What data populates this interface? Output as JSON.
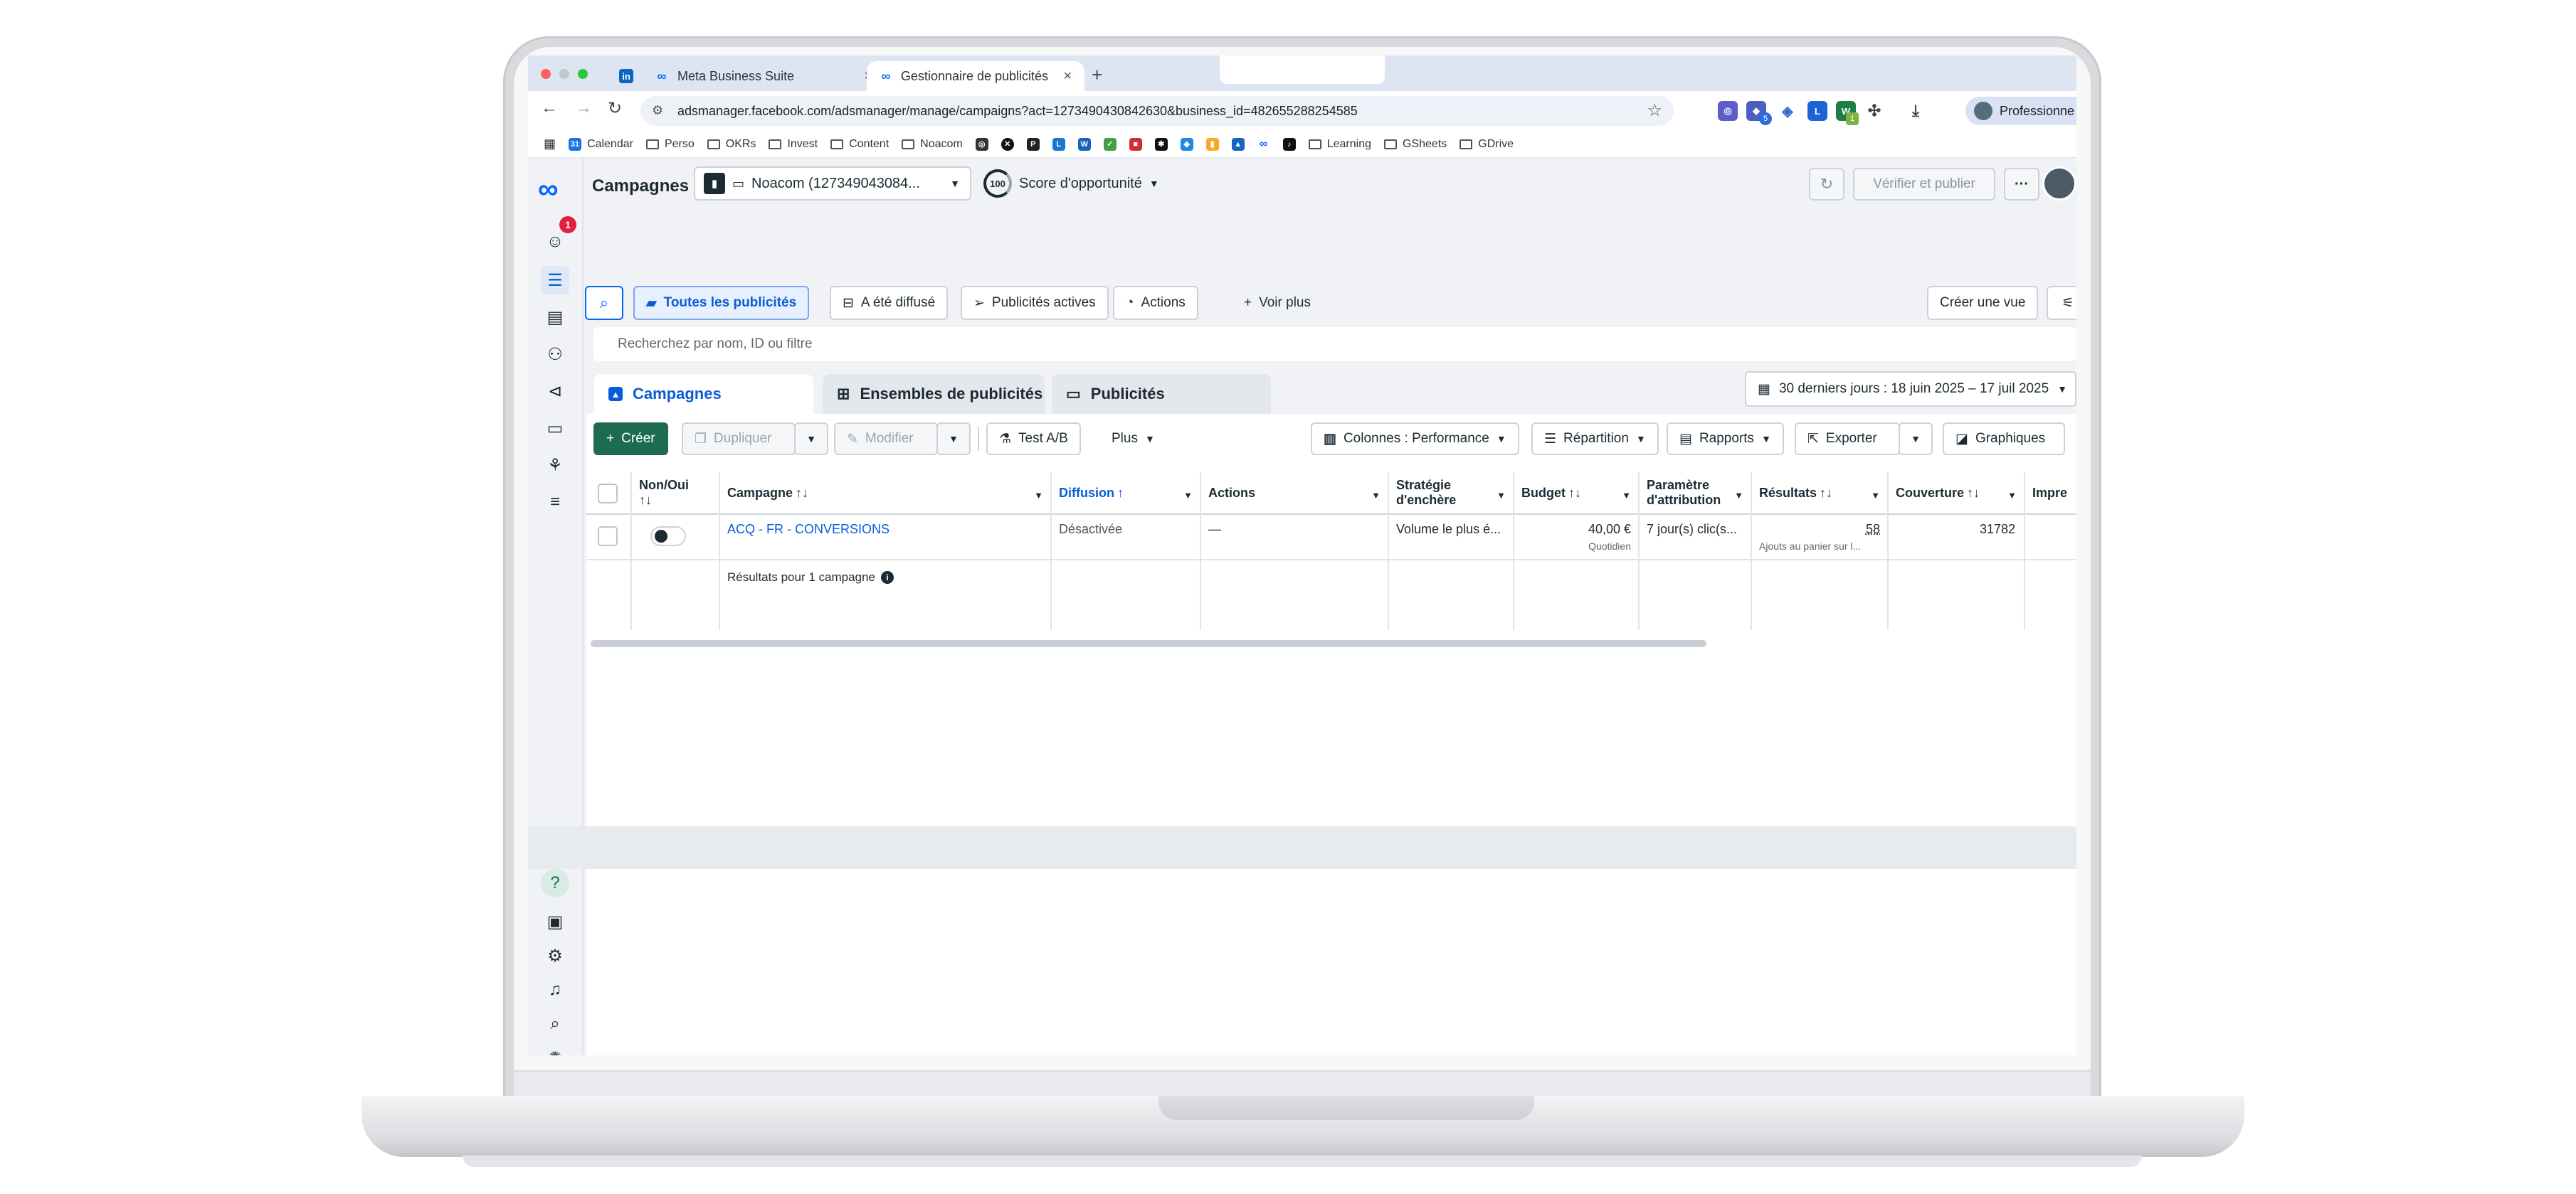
{
  "browser": {
    "tabs": [
      {
        "label": "Meta Business Suite"
      },
      {
        "label": "Gestionnaire de publicités - G"
      }
    ],
    "new_tab": "+",
    "url": "adsmanager.facebook.com/adsmanager/manage/campaigns?act=1273490430842630&business_id=482655288254585",
    "profile": "Professionne",
    "bookmarks": [
      "Calendar",
      "Perso",
      "OKRs",
      "Invest",
      "Content",
      "Noacom",
      "Learning",
      "GSheets",
      "GDrive"
    ],
    "ext_badges": [
      "5",
      "1"
    ]
  },
  "header": {
    "title": "Campagnes",
    "account": "Noacom (127349043084...",
    "opportunity_score": "100",
    "opportunity_label": "Score d'opportunité",
    "verify_label": "Vérifier et publier",
    "more": "···"
  },
  "rail": {
    "badge": "1"
  },
  "filters": {
    "all_ads": "Toutes les publicités",
    "delivered": "A été diffusé",
    "active_ads": "Publicités actives",
    "actions": "Actions",
    "see_more": "Voir plus",
    "create_view": "Créer une vue",
    "search_placeholder": "Recherchez par nom, ID ou filtre"
  },
  "levels": {
    "campaigns": "Campagnes",
    "adsets": "Ensembles de publicités",
    "ads": "Publicités"
  },
  "date_range": "30 derniers jours : 18 juin 2025 – 17 juil 2025",
  "actions_bar": {
    "create": "Créer",
    "duplicate": "Dupliquer",
    "edit": "Modifier",
    "ab_test": "Test A/B",
    "more": "Plus",
    "columns": "Colonnes : Performance",
    "breakdown": "Répartition",
    "reports": "Rapports",
    "export": "Exporter",
    "charts": "Graphiques"
  },
  "table": {
    "headers": {
      "onoff_1": "Non/Oui",
      "onoff_2": "↑↓",
      "campaign": "Campagne",
      "delivery": "Diffusion",
      "actions": "Actions",
      "bid_1": "Stratégie",
      "bid_2": "d'enchère",
      "budget": "Budget",
      "attr_1": "Paramètre",
      "attr_2": "d'attribution",
      "results": "Résultats",
      "reach": "Couverture",
      "impressions": "Impre"
    },
    "row": {
      "campaign": "ACQ - FR - CONVERSIONS",
      "delivery": "Désactivée",
      "actions": "—",
      "bid": "Volume le plus é...",
      "budget": "40,00 €",
      "budget_sub": "Quotidien",
      "attribution": "7 jour(s) clic(s...",
      "results": "58",
      "results_sub": "Ajouts au panier sur l...",
      "reach": "31782"
    },
    "footer": "Résultats pour 1 campagne"
  }
}
